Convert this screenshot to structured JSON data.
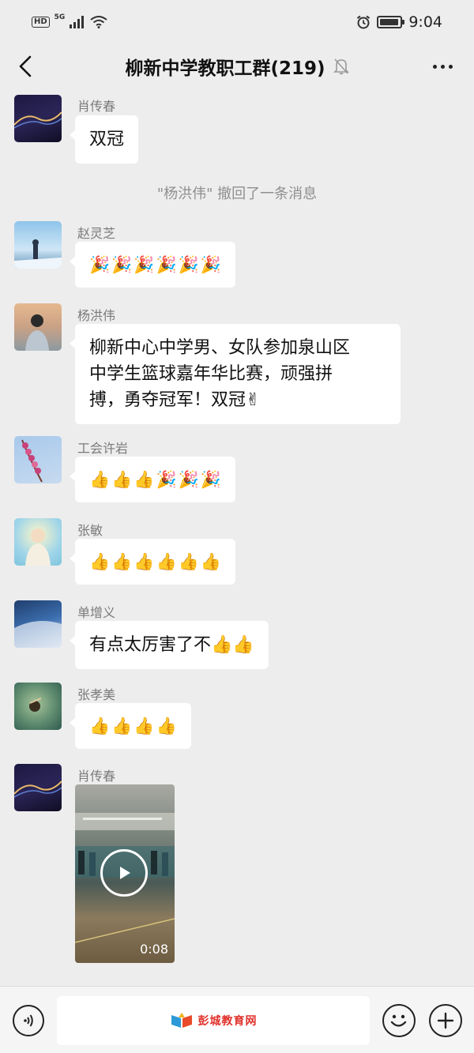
{
  "status_bar": {
    "hd_label": "HD",
    "network_label": "5G",
    "time": "9:04"
  },
  "title_bar": {
    "title": "柳新中学教职工群(219)"
  },
  "messages": [
    {
      "sender": "肖传春",
      "text": "双冠"
    },
    {
      "system": "\"杨洪伟\" 撤回了一条消息"
    },
    {
      "sender": "赵灵芝",
      "emoji": [
        "party-popper",
        "party-popper",
        "party-popper",
        "party-popper",
        "party-popper",
        "party-popper"
      ]
    },
    {
      "sender": "杨洪伟",
      "text_lines": [
        "柳新中心中学男、女队参加泉山区",
        "中学生篮球嘉年华比赛，顽强拼",
        "搏，勇夺冠军！双冠✌"
      ]
    },
    {
      "sender": "工会许岩",
      "emoji": [
        "thumbs-up",
        "thumbs-up",
        "thumbs-up",
        "party-popper",
        "party-popper",
        "party-popper"
      ]
    },
    {
      "sender": "张敏",
      "emoji": [
        "thumbs-up",
        "thumbs-up",
        "thumbs-up",
        "thumbs-up",
        "thumbs-up",
        "thumbs-up"
      ]
    },
    {
      "sender": "单增义",
      "text": "有点太厉害了不👍👍"
    },
    {
      "sender": "张孝美",
      "emoji": [
        "thumbs-up",
        "thumbs-up",
        "thumbs-up",
        "thumbs-up"
      ]
    },
    {
      "sender": "肖传春",
      "video_duration": "0:08"
    }
  ],
  "bottom_bar": {
    "watermark": "彭城教育网"
  },
  "colors": {
    "background": "#ededed",
    "bubble": "#ffffff",
    "sender_name": "#7a7a7a"
  }
}
